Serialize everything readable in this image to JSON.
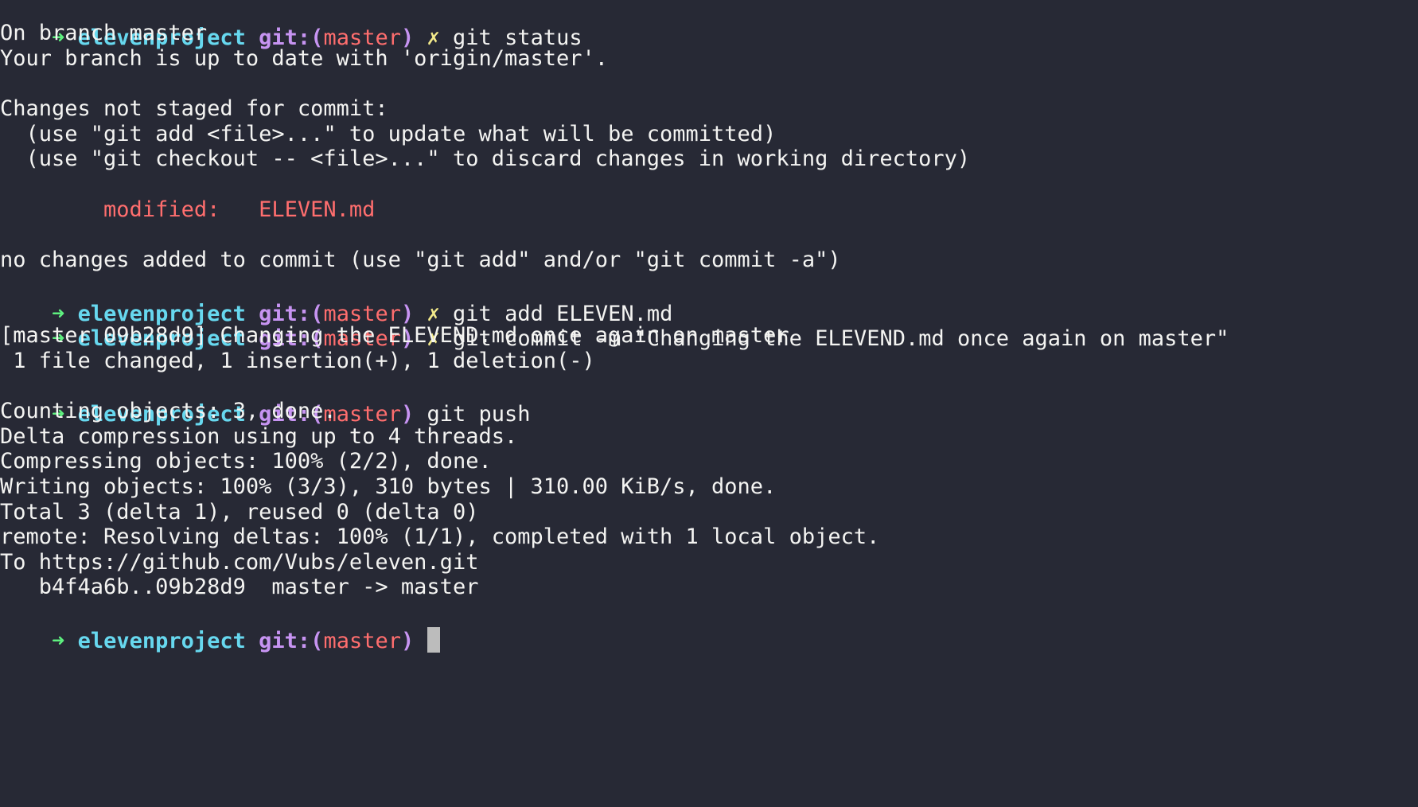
{
  "prompt": {
    "arrow": "➜",
    "dir": "elevenproject",
    "git_prefix": "git:(",
    "branch": "master",
    "git_suffix": ")",
    "dirty_mark": "✗"
  },
  "commands": {
    "status": "git status",
    "add": "git add ELEVEN.md",
    "commit": "git commit -m \"Changing the ELEVEND.md once again on master\"",
    "push": "git push"
  },
  "output": {
    "status": [
      "On branch master",
      "Your branch is up to date with 'origin/master'.",
      "",
      "Changes not staged for commit:",
      "  (use \"git add <file>...\" to update what will be committed)",
      "  (use \"git checkout -- <file>...\" to discard changes in working directory)"
    ],
    "modified_label": "modified:",
    "modified_file": "ELEVEN.md",
    "no_changes": "no changes added to commit (use \"git add\" and/or \"git commit -a\")",
    "commit": [
      "[master 09b28d9] Changing the ELEVEND.md once again on master",
      " 1 file changed, 1 insertion(+), 1 deletion(-)"
    ],
    "push": [
      "Counting objects: 3, done.",
      "Delta compression using up to 4 threads.",
      "Compressing objects: 100% (2/2), done.",
      "Writing objects: 100% (3/3), 310 bytes | 310.00 KiB/s, done.",
      "Total 3 (delta 1), reused 0 (delta 0)",
      "remote: Resolving deltas: 100% (1/1), completed with 1 local object.",
      "To https://github.com/Vubs/eleven.git",
      "   b4f4a6b..09b28d9  master -> master"
    ]
  },
  "colors": {
    "background": "#272935",
    "foreground": "#f4f4f2",
    "arrow": "#5ef07f",
    "directory": "#67d8ef",
    "git": "#c794f2",
    "branch": "#ff6e6e",
    "dirty": "#f2e98a"
  }
}
